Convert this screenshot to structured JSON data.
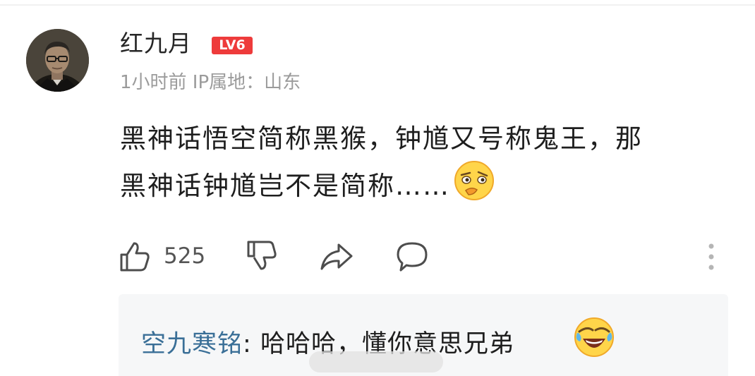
{
  "comment": {
    "username": "红九月",
    "level_badge": "LV6",
    "meta": "1小时前 IP属地：山东",
    "content_line1": "黑神话悟空简称黑猴，钟馗又号称鬼王，那",
    "content_line2": "黑神话钟馗岂不是简称……",
    "inline_emoji": "smirk-emoji"
  },
  "actions": {
    "like_icon": "thumbs-up-icon",
    "like_count": "525",
    "dislike_icon": "thumbs-down-icon",
    "share_icon": "share-icon",
    "comment_icon": "comment-bubble-icon",
    "more_icon": "more-vertical-icon"
  },
  "reply": {
    "author": "空九寒铭",
    "separator": ": ",
    "text": "哈哈哈，懂你意思兄弟",
    "emoji": "laughing-crying-emoji"
  },
  "colors": {
    "badge": "#ee3b3b",
    "reply_author": "#3a6f97",
    "text_primary": "#1e1e1e",
    "text_secondary": "#9b9b9b",
    "reply_background": "#f6f7f8"
  }
}
